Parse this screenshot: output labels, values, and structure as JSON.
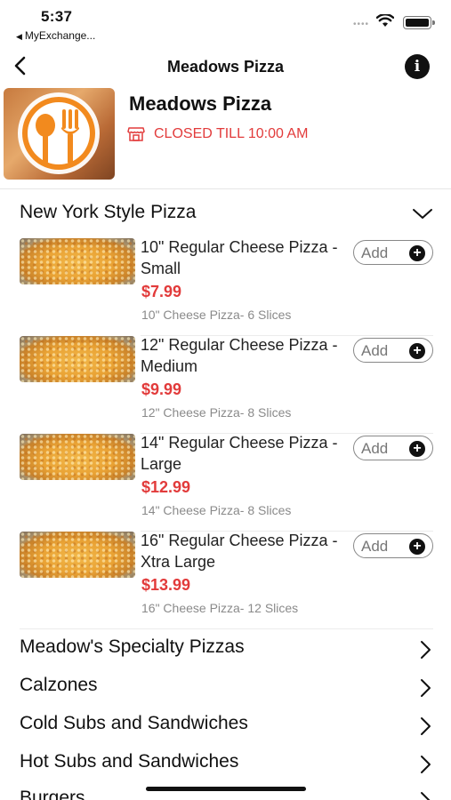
{
  "status_bar": {
    "time": "5:37",
    "back_app": "MyExchange...",
    "back_arrow": "◀"
  },
  "nav": {
    "title": "Meadows Pizza",
    "info_glyph": "i"
  },
  "restaurant": {
    "name": "Meadows Pizza",
    "status": "CLOSED TILL 10:00 AM",
    "status_color": "#e23b3b"
  },
  "section": {
    "title": "New York Style Pizza"
  },
  "items": [
    {
      "name": "10\" Regular Cheese Pizza - Small",
      "price": "$7.99",
      "desc": "10\" Cheese Pizza- 6 Slices",
      "add": "Add"
    },
    {
      "name": "12\" Regular Cheese Pizza - Medium",
      "price": "$9.99",
      "desc": "12\" Cheese Pizza- 8 Slices",
      "add": "Add"
    },
    {
      "name": "14\" Regular Cheese Pizza - Large",
      "price": "$12.99",
      "desc": "14\" Cheese Pizza- 8 Slices",
      "add": "Add"
    },
    {
      "name": "16\" Regular Cheese Pizza - Xtra Large",
      "price": "$13.99",
      "desc": "16\" Cheese Pizza- 12 Slices",
      "add": "Add"
    }
  ],
  "categories": [
    {
      "label": "Meadow's Specialty Pizzas"
    },
    {
      "label": "Calzones"
    },
    {
      "label": "Cold Subs and Sandwiches"
    },
    {
      "label": "Hot Subs and Sandwiches"
    },
    {
      "label": "Burgers"
    }
  ],
  "icons": {
    "back": "chevron-left-icon",
    "info": "info-icon",
    "store": "store-icon",
    "section_toggle": "chevron-down-icon",
    "category": "chevron-right-icon",
    "add": "plus-circle-icon"
  },
  "colors": {
    "accent": "#e23b3b",
    "logo_orange": "#f28a1e"
  }
}
